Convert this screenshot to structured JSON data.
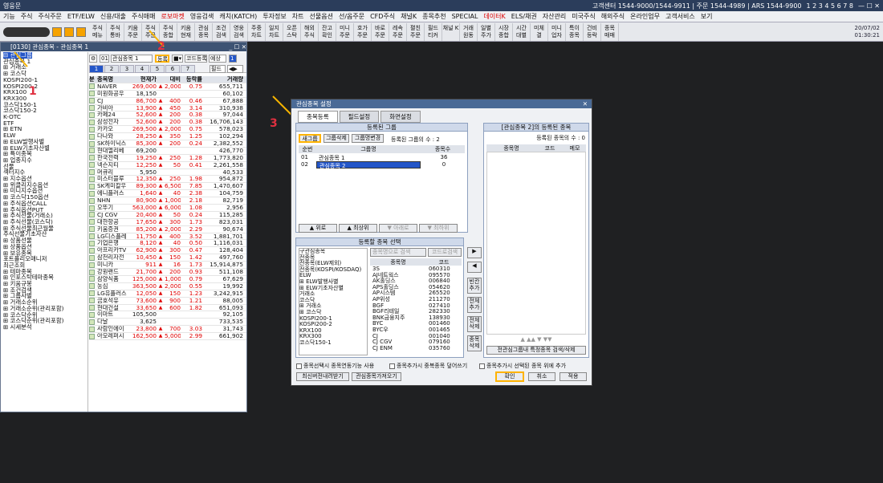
{
  "app": {
    "title": "영웅문",
    "support": "고객센터 1544-9000/1544-9911 | 주문 1544-4989 | ARS 1544-9900",
    "pages": "1 2 3 4 5 6 7 8"
  },
  "menu": [
    "기능",
    "주식",
    "주식주문",
    "ETF/ELW",
    "신용/대출",
    "주식매매",
    "로보마켓",
    "영웅검색",
    "캐치(KATCH)",
    "투자정보",
    "차트",
    "선물옵션",
    "선/옵주문",
    "CFD주식",
    "채널K",
    "종목추천",
    "SPECIAL",
    "데이터K",
    "ELS/채권",
    "자산관리",
    "미국주식",
    "해외주식",
    "온라인업무",
    "고객서비스",
    "보기"
  ],
  "toolbar": {
    "buttons": [
      "주식 메뉴",
      "주식 통바",
      "키움 주문",
      "주식 주문",
      "주식 종합",
      "키움 현재",
      "관심 종목",
      "조건 검색",
      "영웅 검색",
      "주중 차트",
      "일지 차트",
      "오픈 스탁",
      "해외 주식",
      "잔고 확인",
      "미니 주문",
      "호가 주문",
      "바로 주문",
      "레속 주문",
      "펼친 주문",
      "필드 티커",
      "채널 K",
      "거래 원동",
      "일별 주가",
      "시장 종합",
      "시간 대별",
      "미체 결",
      "미니 업자",
      "특이 종목",
      "건비 등락",
      "종목 매매"
    ],
    "date": "20/07/02",
    "time": "01:30:21"
  },
  "leftwin": {
    "title": "[0130] 관심종목 - 관심종목 1",
    "tree": [
      {
        "t": "⊟ 관심그룹",
        "sel": true
      },
      {
        "t": "  관심종목 1"
      },
      {
        "t": "⊞ 거래소"
      },
      {
        "t": "⊞ 코스닥"
      },
      {
        "t": "  KOSPI200-1"
      },
      {
        "t": "  KOSPI200-2"
      },
      {
        "t": "  KRX100"
      },
      {
        "t": "  KRX300"
      },
      {
        "t": "  코스닥150-1"
      },
      {
        "t": "  코스닥150-2"
      },
      {
        "t": "  K-OTC"
      },
      {
        "t": "  ETF"
      },
      {
        "t": "⊞ ETN"
      },
      {
        "t": "  ELW"
      },
      {
        "t": "⊞ ELW발행사별"
      },
      {
        "t": "⊞ ELW기초자산별"
      },
      {
        "t": "⊞ 특이종목"
      },
      {
        "t": "⊞ 업종지수"
      },
      {
        "t": "  선물"
      },
      {
        "t": "  섹터지수"
      },
      {
        "t": "⊞ 지수옵션"
      },
      {
        "t": "⊞ 위클리지수옵션"
      },
      {
        "t": "⊞ 미니지수옵션"
      },
      {
        "t": "⊞ 코스닥150옵션"
      },
      {
        "t": "⊞ 주식옵션CALL"
      },
      {
        "t": "⊞ 주식옵션PUT"
      },
      {
        "t": "⊞ 주식선물(거래소)"
      },
      {
        "t": "⊞ 주식선물(코스닥)"
      },
      {
        "t": "⊞ 주식선물최근월물"
      },
      {
        "t": "  주식선물기초자산"
      },
      {
        "t": "⊞ 상품선물"
      },
      {
        "t": "⊞ 상품옵션"
      },
      {
        "t": "⊞ 보유종목"
      },
      {
        "t": "  포트폴리오매니저"
      },
      {
        "t": "  최근조회"
      },
      {
        "t": "⊞ 테마종목"
      },
      {
        "t": "⊞ 인포스탁테마종목"
      },
      {
        "t": "⊞ 키움규봉"
      },
      {
        "t": "⊞ 조건검색"
      },
      {
        "t": "⊞ 그룹사별"
      },
      {
        "t": "⊞ 거래소순위"
      },
      {
        "t": "⊞ 거래소순위(관리포함)"
      },
      {
        "t": "⊞ 코스닥순위"
      },
      {
        "t": "⊞ 코스닥순위(관리포함)"
      },
      {
        "t": "⊞ 시세분석"
      }
    ],
    "controls": {
      "num": "01",
      "group": "관심종목 1",
      "register": "등록",
      "code_reg": "코드등록",
      "forecast": "예상",
      "field": "필드",
      "page": "1",
      "pages": [
        "1",
        "2",
        "3",
        "4",
        "5",
        "6",
        "7"
      ]
    },
    "headers": [
      "분",
      "종목명",
      "현재가",
      "",
      "대비",
      "등락률",
      "거래량"
    ],
    "rows": [
      [
        "NAVER",
        "269,000",
        "▲",
        "2,000",
        "0.75",
        "655,711",
        "up"
      ],
      [
        "미원화공우",
        "18,150",
        "",
        "",
        "",
        "60,102",
        "n"
      ],
      [
        "CJ",
        "86,700",
        "▲",
        "400",
        "0.46",
        "67,888",
        "up"
      ],
      [
        "가비아",
        "13,900",
        "▲",
        "450",
        "3.14",
        "310,938",
        "up"
      ],
      [
        "카페24",
        "52,600",
        "▲",
        "200",
        "0.38",
        "97,044",
        "up"
      ],
      [
        "삼성전자",
        "52,600",
        "▲",
        "200",
        "0.38",
        "16,706,143",
        "up"
      ],
      [
        "카카오",
        "269,500",
        "▲",
        "2,000",
        "0.75",
        "578,023",
        "up"
      ],
      [
        "다나와",
        "28,250",
        "▲",
        "350",
        "1.25",
        "102,294",
        "up"
      ],
      [
        "SK하이닉스",
        "85,300",
        "▲",
        "200",
        "0.24",
        "2,382,552",
        "up"
      ],
      [
        "현대엘리베",
        "69,200",
        "",
        "",
        "",
        "426,770",
        "n"
      ],
      [
        "한국전력",
        "19,250",
        "▲",
        "250",
        "1.28",
        "1,773,820",
        "up"
      ],
      [
        "넥슨지티",
        "12,250",
        "▲",
        "50",
        "0.41",
        "2,261,558",
        "up"
      ],
      [
        "머큐리",
        "5,950",
        "",
        "",
        "",
        "40,533",
        "n"
      ],
      [
        "미스터블루",
        "12,350",
        "▲",
        "250",
        "1.98",
        "954,872",
        "up"
      ],
      [
        "SK케미칼우",
        "89,300",
        "▲",
        "6,500",
        "7.85",
        "1,470,607",
        "up"
      ],
      [
        "에니플러스",
        "1,640",
        "▲",
        "40",
        "2.38",
        "104,759",
        "up"
      ],
      [
        "NHN",
        "80,900",
        "▲",
        "1,000",
        "2.18",
        "82,719",
        "up"
      ],
      [
        "오뚜기",
        "563,000",
        "▲",
        "6,000",
        "1.08",
        "2,956",
        "up"
      ],
      [
        "CJ CGV",
        "20,400",
        "▲",
        "50",
        "0.24",
        "115,285",
        "up"
      ],
      [
        "대한항공",
        "17,650",
        "▲",
        "300",
        "1.73",
        "823,031",
        "up"
      ],
      [
        "키움증권",
        "85,200",
        "▲",
        "2,000",
        "2.29",
        "90,674",
        "up"
      ],
      [
        "LG디스플레",
        "11,750",
        "▲",
        "400",
        "3.52",
        "1,881,701",
        "up"
      ],
      [
        "기업은행",
        "8,120",
        "▲",
        "40",
        "0.50",
        "1,116,031",
        "up"
      ],
      [
        "아프리카TV",
        "62,900",
        "▲",
        "300",
        "0.47",
        "128,404",
        "up"
      ],
      [
        "삼천리자전",
        "10,450",
        "▲",
        "150",
        "1.42",
        "497,760",
        "up"
      ],
      [
        "미니카",
        "911",
        "▲",
        "16",
        "1.73",
        "15,914,875",
        "up"
      ],
      [
        "강원랜드",
        "21,700",
        "▲",
        "200",
        "0.93",
        "511,108",
        "up"
      ],
      [
        "삼양식품",
        "125,000",
        "▲",
        "1,000",
        "0.79",
        "67,629",
        "up"
      ],
      [
        "농심",
        "363,500",
        "▲",
        "2,000",
        "0.55",
        "19,992",
        "up"
      ],
      [
        "LG유플러스",
        "12,050",
        "▲",
        "150",
        "1.23",
        "3,242,915",
        "up"
      ],
      [
        "금호석유",
        "73,600",
        "▲",
        "900",
        "1.21",
        "88,005",
        "up"
      ],
      [
        "현대건설",
        "33,650",
        "▲",
        "600",
        "1.82",
        "651,093",
        "up"
      ],
      [
        "이마트",
        "105,500",
        "",
        "",
        "",
        "92,105",
        "n"
      ],
      [
        "다날",
        "3,625",
        "",
        "",
        "",
        "733,535",
        "n"
      ],
      [
        "사람인에이",
        "23,800",
        "▲",
        "700",
        "3.03",
        "31,743",
        "up"
      ],
      [
        "아모레퍼시",
        "162,500",
        "▲",
        "5,000",
        "2.99",
        "661,902",
        "up"
      ]
    ]
  },
  "dialog": {
    "title": "관심종목 설정",
    "tabs": [
      "종목등록",
      "필드설정",
      "화면설정"
    ],
    "group_panel": {
      "title": "등록된 그룹",
      "btn_new": "새그룹",
      "btn_del": "그룹삭제",
      "btn_rename": "그룹명변경",
      "count_text": "등록된 그룹의 수 : 2",
      "cols": [
        "순번",
        "그룹명",
        "종목수"
      ],
      "rows": [
        [
          "01",
          "관심종목 1",
          "36"
        ],
        [
          "02",
          "관심종목 2",
          "0"
        ]
      ],
      "up": "▲ 위로",
      "top": "▲ 최상위",
      "down": "▼ 아래로",
      "bottom": "▼ 최하위"
    },
    "select_panel": {
      "title": "등록할 종목 선택",
      "tree": [
        "구관심종목",
        "전종목",
        "전종목(ELW제외)",
        "전종목(KOSPI/KOSDAQ)",
        "ELW",
        "⊞ ELW발행사별",
        "⊞ ELW기초자산별",
        "  거래소",
        "  코스닥",
        "⊞ 거래소",
        "⊞ 코스닥",
        "  KOSPI200-1",
        "  KOSPI200-2",
        "  KRX100",
        "  KRX300",
        "  코스닥150-1"
      ],
      "search_ph": "종목명으로 검색",
      "search_btn": "코드로검색",
      "cols": [
        "종목명",
        "코드"
      ],
      "stocks": [
        [
          "3S",
          "060310"
        ],
        [
          "AJ네트웍스",
          "095570"
        ],
        [
          "AK홀딩스",
          "006840"
        ],
        [
          "APS홀딩스",
          "054620"
        ],
        [
          "AP시스템",
          "265520"
        ],
        [
          "AP위성",
          "211270"
        ],
        [
          "BGF",
          "027410"
        ],
        [
          "BGF리테일",
          "282330"
        ],
        [
          "BNK금융지주",
          "138930"
        ],
        [
          "BYC",
          "001460"
        ],
        [
          "BYC우",
          "001465"
        ],
        [
          "CJ",
          "001040"
        ],
        [
          "CJ CGV",
          "079160"
        ],
        [
          "CJ ENM",
          "035760"
        ]
      ]
    },
    "mid": {
      "right": "▶",
      "left": "◀",
      "b1": "빈칸추가",
      "b2": "전체추가",
      "b3": "전체삭제",
      "b4": "종목삭제"
    },
    "right_panel": {
      "title": "[관심종목 2]의 등록된 종목",
      "count_text": "등록된 종목의 수 : 0",
      "cols": [
        "종목명",
        "코드",
        "메모"
      ],
      "search_btn": "전관심그룹내 특정종목 검색/삭제"
    },
    "chk1": "종목선택시 종목연동기능 사용",
    "chk2": "종목추가시 중복종목 덮어쓰기",
    "chk3": "종목추가시 선택된 종목 위에 추가",
    "btn_server": "최신버전내려받기",
    "btn_import": "관심종목가져오기",
    "ok": "확인",
    "cancel": "취소",
    "apply": "적용"
  },
  "annotations": {
    "a1": "1",
    "a2": "2",
    "a3": "3"
  }
}
